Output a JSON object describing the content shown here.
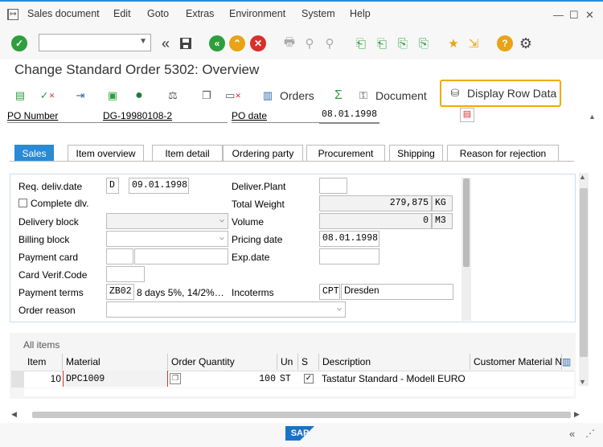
{
  "menu": {
    "items": [
      "Sales document",
      "Edit",
      "Goto",
      "Extras",
      "Environment",
      "System",
      "Help"
    ]
  },
  "window": {
    "title": "Change Standard Order 5302: Overview"
  },
  "app_toolbar": {
    "orders_label": "Orders",
    "document_label": "Document",
    "display_row_data_label": "Display Row Data"
  },
  "header": {
    "po_number_label": "PO Number",
    "po_number_value": "DG-19980108-2",
    "po_date_label": "PO date",
    "po_date_value": "08.01.1998"
  },
  "tabs": [
    "Sales",
    "Item overview",
    "Item detail",
    "Ordering party",
    "Procurement",
    "Shipping",
    "Reason for rejection"
  ],
  "sales_tab": {
    "req_deliv_date_label": "Req. deliv.date",
    "req_deliv_date_format": "D",
    "req_deliv_date_value": "09.01.1998",
    "deliver_plant_label": "Deliver.Plant",
    "complete_dlv_label": "Complete dlv.",
    "total_weight_label": "Total Weight",
    "total_weight_value": "279,875",
    "total_weight_unit": "KG",
    "delivery_block_label": "Delivery block",
    "volume_label": "Volume",
    "volume_value": "0",
    "volume_unit": "M3",
    "billing_block_label": "Billing block",
    "pricing_date_label": "Pricing date",
    "pricing_date_value": "08.01.1998",
    "payment_card_label": "Payment card",
    "exp_date_label": "Exp.date",
    "card_verif_label": "Card Verif.Code",
    "payment_terms_label": "Payment terms",
    "payment_terms_code": "ZB02",
    "payment_terms_text": "8 days 5%, 14/2%…",
    "incoterms_label": "Incoterms",
    "incoterms_code": "CPT",
    "incoterms_place": "Dresden",
    "order_reason_label": "Order reason"
  },
  "items_table": {
    "title": "All items",
    "columns": [
      "Item",
      "Material",
      "Order Quantity",
      "Un",
      "S",
      "Description",
      "Customer Material Nu"
    ],
    "rows": [
      {
        "item": "10",
        "material": "DPC1009",
        "quantity": "100",
        "unit": "ST",
        "description": "Tastatur Standard - Modell EURO"
      }
    ]
  },
  "footer": {
    "brand": "SAP"
  }
}
